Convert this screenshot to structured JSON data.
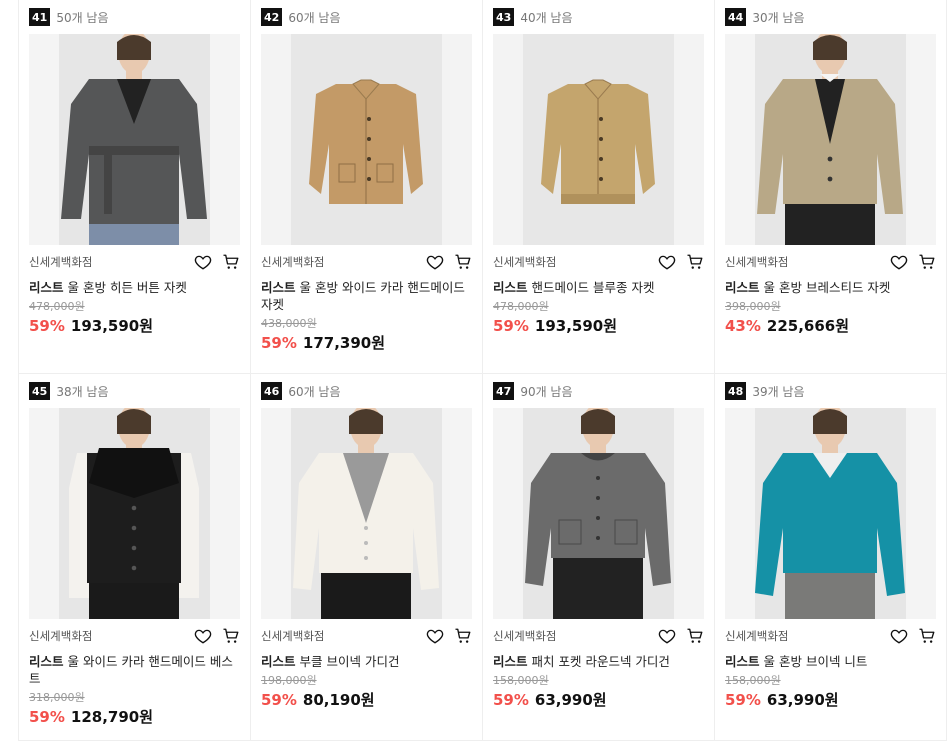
{
  "products": [
    {
      "rank": "41",
      "remain": "50개 남음",
      "store": "신세계백화점",
      "brand": "리스트",
      "name": "울 혼방 히든 버튼 자켓",
      "orig": "478,000원",
      "pct": "59%",
      "price": "193,590원",
      "art": {
        "type": "belted",
        "bg": "#f2f2f2",
        "color": "#555657",
        "inner": "#222"
      }
    },
    {
      "rank": "42",
      "remain": "60개 남음",
      "store": "신세계백화점",
      "brand": "리스트",
      "name": "울 혼방 와이드 카라 핸드메이드 자켓",
      "orig": "438,000원",
      "pct": "59%",
      "price": "177,390원",
      "art": {
        "type": "flat-jacket",
        "bg": "#e7e7e7",
        "color": "#c39a67",
        "inner": "#c39a67"
      }
    },
    {
      "rank": "43",
      "remain": "40개 남음",
      "store": "신세계백화점",
      "brand": "리스트",
      "name": "핸드메이드 블루종 자켓",
      "orig": "478,000원",
      "pct": "59%",
      "price": "193,590원",
      "art": {
        "type": "flat-blouson",
        "bg": "#e7e7e7",
        "color": "#c4a56d",
        "inner": "#c4a56d"
      }
    },
    {
      "rank": "44",
      "remain": "30개 남음",
      "store": "신세계백화점",
      "brand": "리스트",
      "name": "울 혼방 브레스티드 자켓",
      "orig": "398,000원",
      "pct": "43%",
      "price": "225,666원",
      "art": {
        "type": "blazer",
        "bg": "#f2f2f2",
        "color": "#b8a887",
        "inner": "#222"
      }
    },
    {
      "rank": "45",
      "remain": "38개 남음",
      "store": "신세계백화점",
      "brand": "리스트",
      "name": "울 와이드 카라 핸드메이드 베스트",
      "orig": "318,000원",
      "pct": "59%",
      "price": "128,790원",
      "art": {
        "type": "vest",
        "bg": "#f2f2f2",
        "color": "#1d1d1d",
        "inner": "#f4f2ee"
      }
    },
    {
      "rank": "46",
      "remain": "60개 남음",
      "store": "신세계백화점",
      "brand": "리스트",
      "name": "부클 브이넥 가디건",
      "orig": "198,000원",
      "pct": "59%",
      "price": "80,190원",
      "art": {
        "type": "cardigan-v",
        "bg": "#f2f2f2",
        "color": "#f4f1ea",
        "inner": "#9a9a9a"
      }
    },
    {
      "rank": "47",
      "remain": "90개 남음",
      "store": "신세계백화점",
      "brand": "리스트",
      "name": "패치 포켓 라운드넥 가디건",
      "orig": "158,000원",
      "pct": "59%",
      "price": "63,990원",
      "art": {
        "type": "cardigan-round",
        "bg": "#f2f2f2",
        "color": "#6b6b6b",
        "inner": "#222"
      }
    },
    {
      "rank": "48",
      "remain": "39개 남음",
      "store": "신세계백화점",
      "brand": "리스트",
      "name": "울 혼방 브이넥 니트",
      "orig": "158,000원",
      "pct": "59%",
      "price": "63,990원",
      "art": {
        "type": "knit-v",
        "bg": "#f2f2f2",
        "color": "#1591a6",
        "inner": "#efefef"
      }
    }
  ],
  "colors": {
    "accent": "#f2504b",
    "rank_bg": "#111111"
  },
  "icons": {
    "wish": "heart-icon",
    "cart": "cart-icon"
  }
}
